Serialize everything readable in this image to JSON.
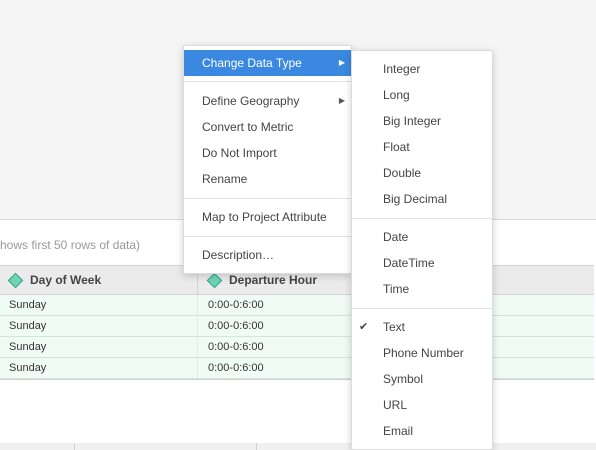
{
  "preview": {
    "note": "hows first 50 rows of data)"
  },
  "grid": {
    "columns": [
      {
        "label": "Day of Week",
        "icon": "attribute-diamond-icon"
      },
      {
        "label": "Departure Hour",
        "icon": "attribute-diamond-icon"
      }
    ],
    "rows": [
      {
        "day": "Sunday",
        "hour": "0:00-0:6:00"
      },
      {
        "day": "Sunday",
        "hour": "0:00-0:6:00"
      },
      {
        "day": "Sunday",
        "hour": "0:00-0:6:00"
      },
      {
        "day": "Sunday",
        "hour": "0:00-0:6:00"
      }
    ]
  },
  "context_menu": {
    "items": [
      {
        "label": "Change Data Type",
        "has_submenu": true,
        "active": true
      },
      {
        "label": "Define Geography",
        "has_submenu": true
      },
      {
        "label": "Convert to Metric"
      },
      {
        "label": "Do Not Import"
      },
      {
        "label": "Rename"
      },
      {
        "label": "Map to Project Attribute"
      },
      {
        "label": "Description…"
      }
    ],
    "active_color": "#3b88e0"
  },
  "data_type_menu": {
    "items": [
      {
        "label": "Integer"
      },
      {
        "label": "Long"
      },
      {
        "label": "Big Integer"
      },
      {
        "label": "Float"
      },
      {
        "label": "Double"
      },
      {
        "label": "Big Decimal"
      },
      {
        "label": "Date"
      },
      {
        "label": "DateTime"
      },
      {
        "label": "Time"
      },
      {
        "label": "Text",
        "checked": true
      },
      {
        "label": "Phone Number"
      },
      {
        "label": "Symbol"
      },
      {
        "label": "URL"
      },
      {
        "label": "Email"
      }
    ]
  }
}
